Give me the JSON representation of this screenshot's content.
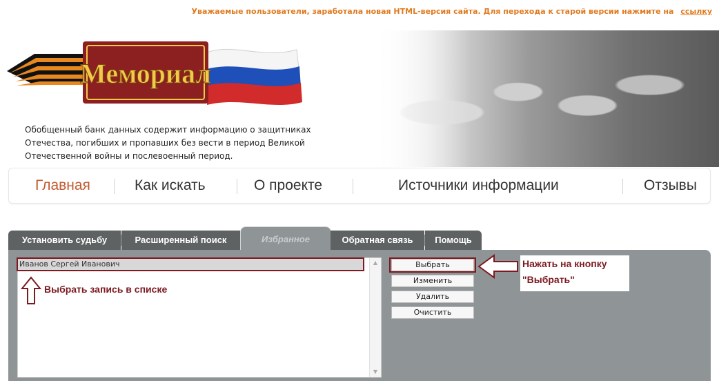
{
  "top_notice": {
    "text": "Уважаемые пользователи, заработала новая HTML-версия сайта. Для перехода к старой версии нажмите на",
    "link": "ссылку"
  },
  "logo": {
    "text": "Мемориал"
  },
  "description": "Обобщенный банк данных содержит информацию о защитниках Отечества, погибших и пропавших без вести в период Великой Отечественной войны и послевоенный период.",
  "nav": {
    "items": [
      {
        "label": "Главная",
        "active": true
      },
      {
        "label": "Как искать"
      },
      {
        "label": "О проекте"
      },
      {
        "label": "Источники информации"
      },
      {
        "label": "Отзывы"
      }
    ]
  },
  "tabs": [
    {
      "label": "Установить судьбу"
    },
    {
      "label": "Расширенный поиск"
    },
    {
      "label": "Избранное",
      "active": true
    },
    {
      "label": "Обратная связь"
    },
    {
      "label": "Помощь"
    }
  ],
  "favorites": {
    "items": [
      "Иванов Сергей Иванович"
    ],
    "buttons": {
      "select": "Выбрать",
      "edit": "Изменить",
      "delete": "Удалить",
      "clear": "Очистить"
    }
  },
  "annotations": {
    "press_button": "Нажать на кнопку \"Выбрать\"",
    "select_record": "Выбрать запись в списке"
  },
  "colors": {
    "accent": "#7b1a20",
    "notice": "#e07a1f",
    "active_nav": "#c15a30",
    "panel": "#8f9596",
    "tab_dark": "#5e6263"
  }
}
